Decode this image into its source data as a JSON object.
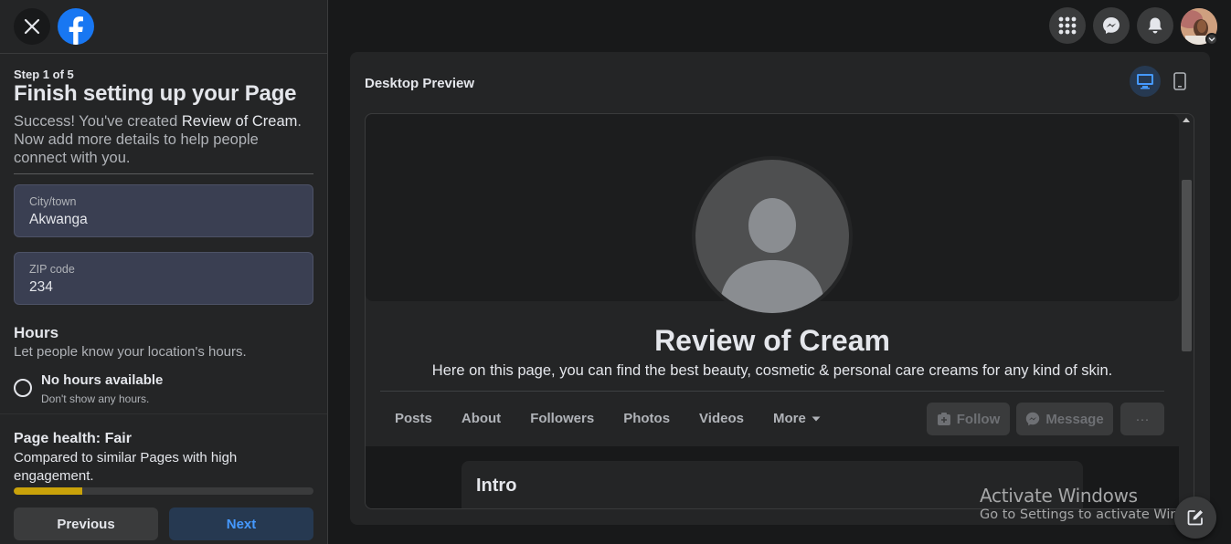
{
  "sidebar": {
    "step": "Step 1 of 5",
    "title": "Finish setting up your Page",
    "desc_prefix": "Success! You've created ",
    "desc_page": "Review of Cream",
    "desc_suffix": ". Now add more details to help people connect with you.",
    "city_label": "City/town",
    "city_value": "Akwanga",
    "zip_label": "ZIP code",
    "zip_value": "234",
    "hours_title": "Hours",
    "hours_sub": "Let people know your location's hours.",
    "no_hours_label": "No hours available",
    "no_hours_sub": "Don't show any hours.",
    "health_title": "Page health: Fair",
    "health_sub": "Compared to similar Pages with high engagement.",
    "health_progress": 0.23,
    "prev_label": "Previous",
    "next_label": "Next"
  },
  "topbar": {
    "icons": [
      "menu-grid-icon",
      "messenger-icon",
      "notifications-bell-icon"
    ]
  },
  "preview": {
    "title": "Desktop Preview",
    "page_name": "Review of Cream",
    "page_bio": "Here on this page, you can find the best beauty, cosmetic & personal care creams for any kind of skin.",
    "tabs": [
      "Posts",
      "About",
      "Followers",
      "Photos",
      "Videos",
      "More"
    ],
    "follow_label": "Follow",
    "message_label": "Message",
    "more_label": "···",
    "intro_title": "Intro"
  },
  "watermark": {
    "title": "Activate Windows",
    "sub": "Go to Settings to activate Windows."
  },
  "colors": {
    "accent": "#1877f2",
    "health_fill": "#c9a20a",
    "next_text": "#4599ff"
  }
}
